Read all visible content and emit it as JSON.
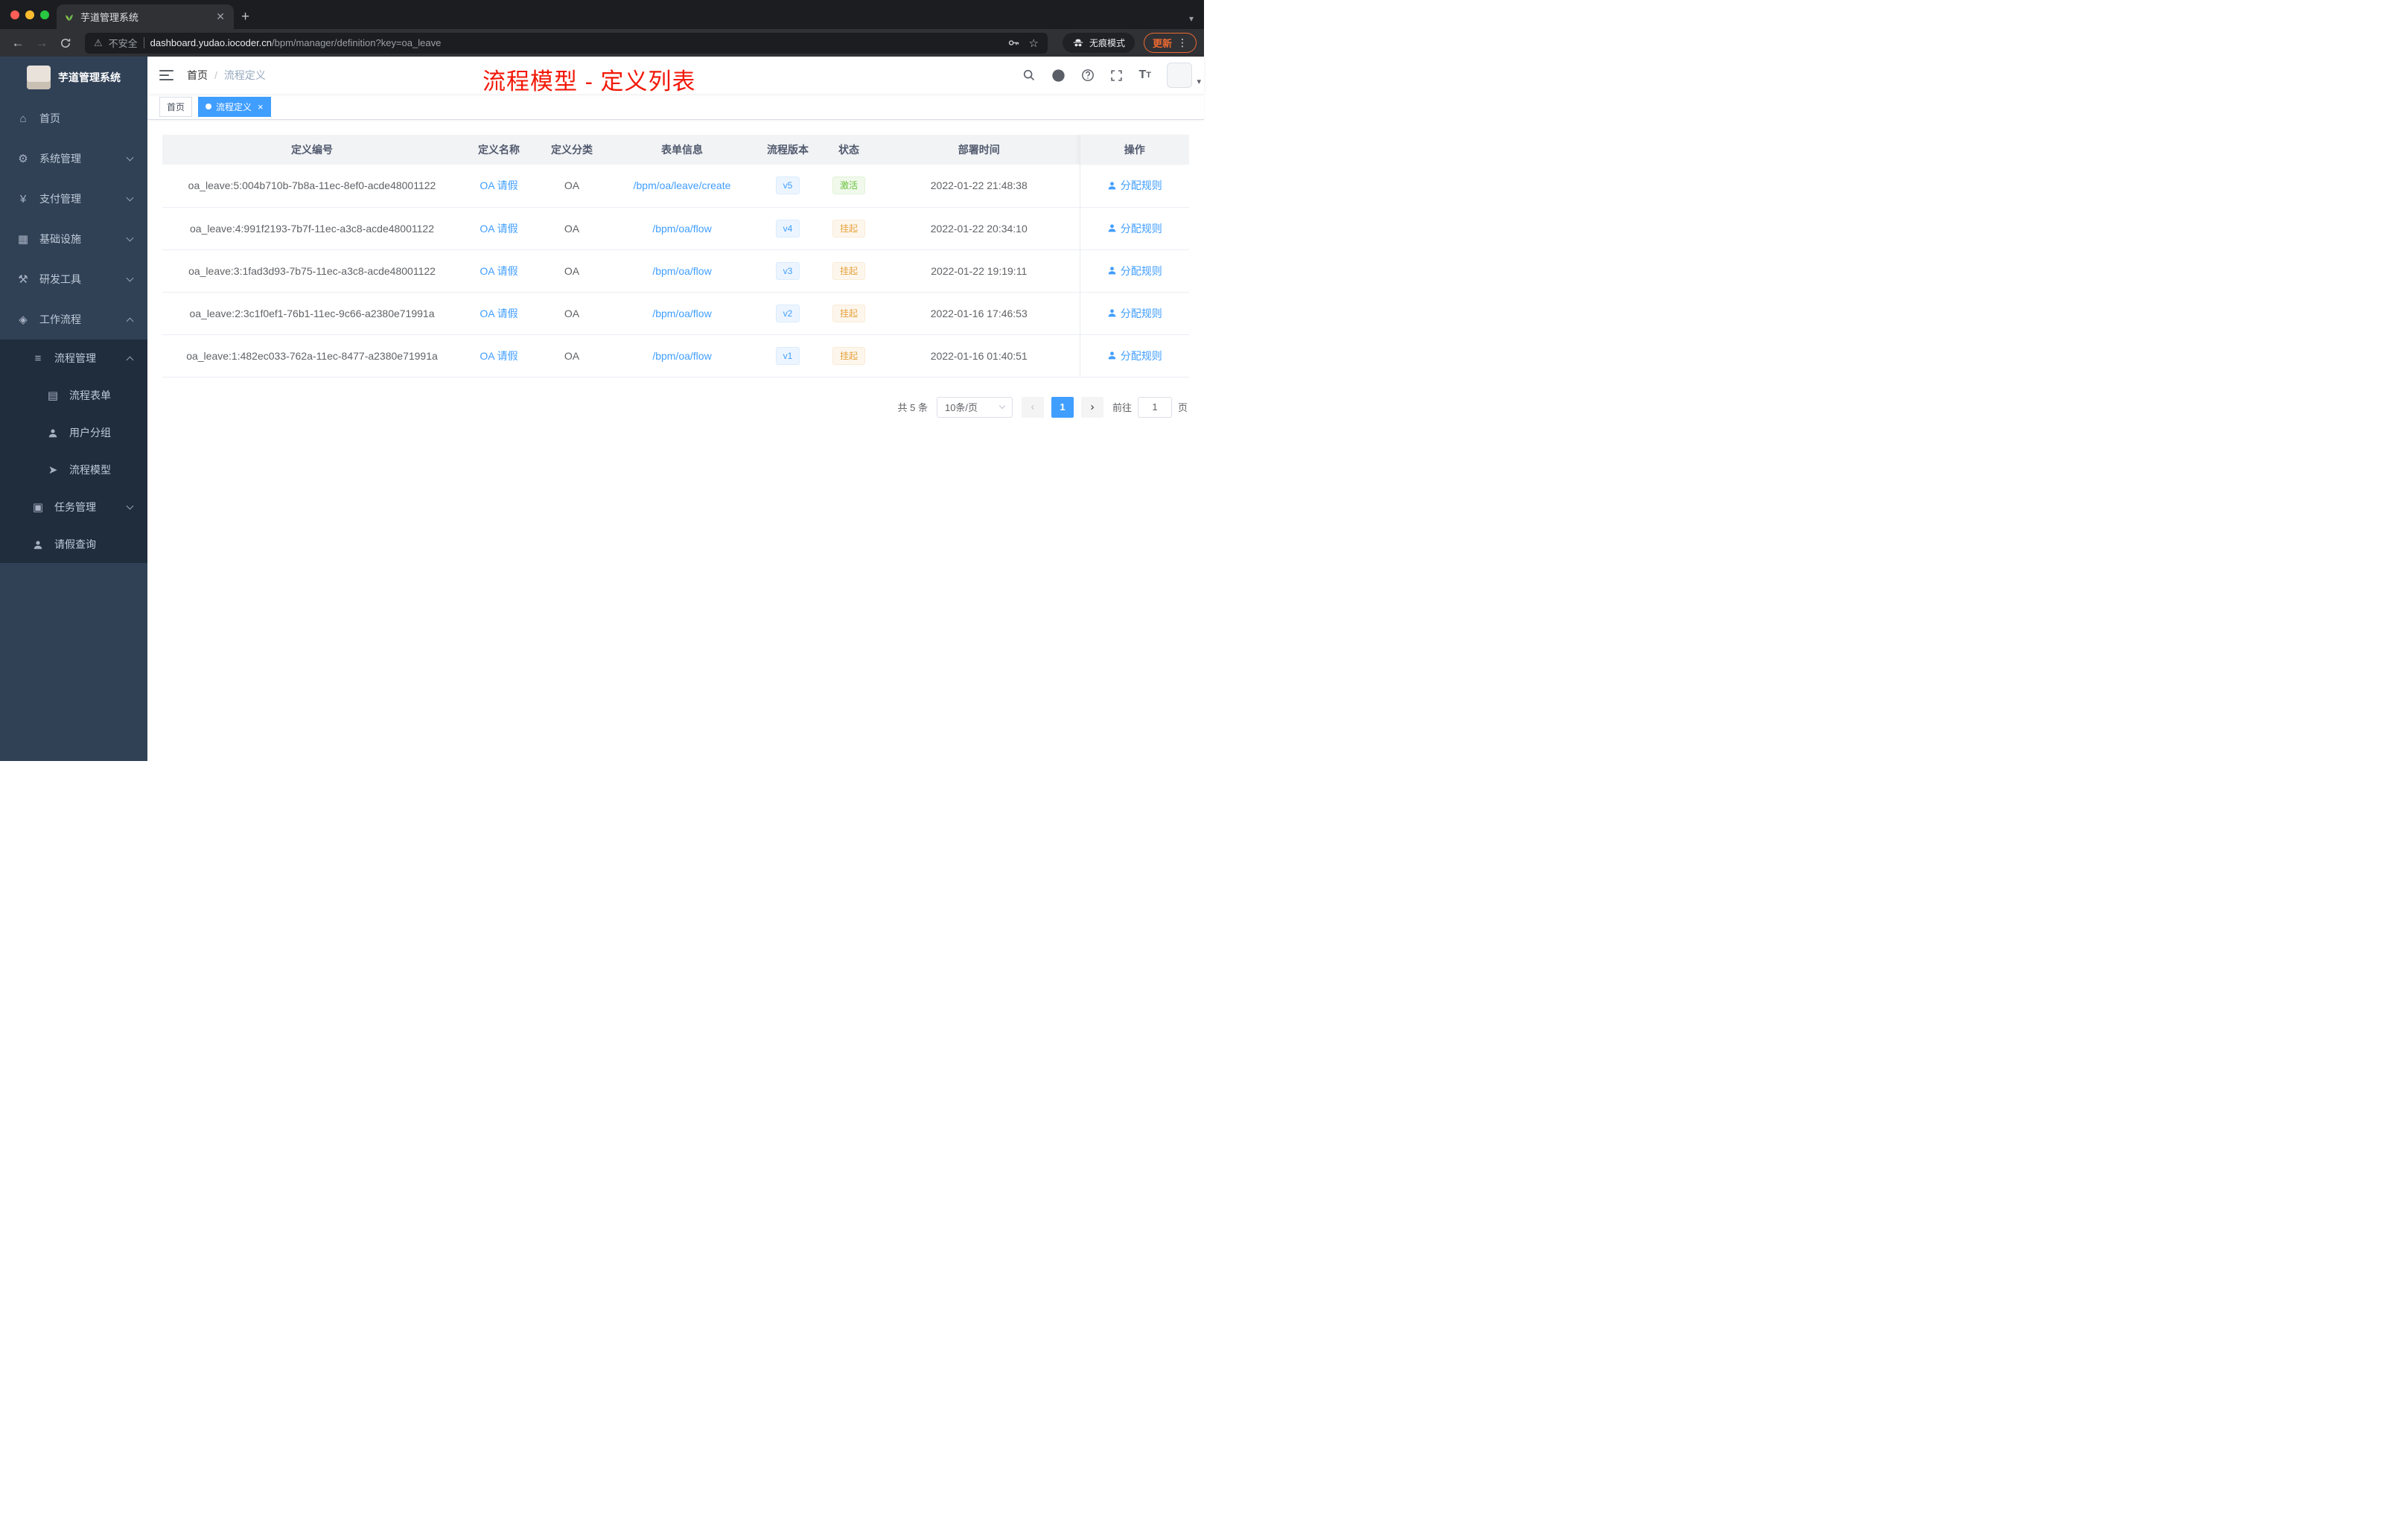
{
  "browser": {
    "tab_title": "芋道管理系统",
    "security_warning": "不安全",
    "url_host": "dashboard.yudao.iocoder.cn",
    "url_path": "/bpm/manager/definition?key=oa_leave",
    "incognito_label": "无痕模式",
    "update_label": "更新"
  },
  "sidebar": {
    "logo_title": "芋道管理系统",
    "items": {
      "home": "首页",
      "system": "系统管理",
      "payment": "支付管理",
      "infra": "基础设施",
      "devtools": "研发工具",
      "workflow": "工作流程",
      "process_mgmt": "流程管理",
      "process_form": "流程表单",
      "user_group": "用户分组",
      "process_model": "流程模型",
      "task_mgmt": "任务管理",
      "leave_query": "请假查询"
    }
  },
  "navbar": {
    "breadcrumb_home": "首页",
    "breadcrumb_sep": "/",
    "breadcrumb_current": "流程定义"
  },
  "annotation": "流程模型 - 定义列表",
  "tags": {
    "first": "首页",
    "active": "流程定义"
  },
  "table": {
    "columns": {
      "id": "定义编号",
      "name": "定义名称",
      "category": "定义分类",
      "form": "表单信息",
      "version": "流程版本",
      "status": "状态",
      "deploy_time": "部署时间",
      "action": "操作"
    },
    "rows": [
      {
        "id": "oa_leave:5:004b710b-7b8a-11ec-8ef0-acde48001122",
        "name": "OA 请假",
        "category": "OA",
        "form": "/bpm/oa/leave/create",
        "version": "v5",
        "status": "激活",
        "time": "2022-01-22 21:48:38",
        "action": "分配规则"
      },
      {
        "id": "oa_leave:4:991f2193-7b7f-11ec-a3c8-acde48001122",
        "name": "OA 请假",
        "category": "OA",
        "form": "/bpm/oa/flow",
        "version": "v4",
        "status": "挂起",
        "time": "2022-01-22 20:34:10",
        "action": "分配规则"
      },
      {
        "id": "oa_leave:3:1fad3d93-7b75-11ec-a3c8-acde48001122",
        "name": "OA 请假",
        "category": "OA",
        "form": "/bpm/oa/flow",
        "version": "v3",
        "status": "挂起",
        "time": "2022-01-22 19:19:11",
        "action": "分配规则"
      },
      {
        "id": "oa_leave:2:3c1f0ef1-76b1-11ec-9c66-a2380e71991a",
        "name": "OA 请假",
        "category": "OA",
        "form": "/bpm/oa/flow",
        "version": "v2",
        "status": "挂起",
        "time": "2022-01-16 17:46:53",
        "action": "分配规则"
      },
      {
        "id": "oa_leave:1:482ec033-762a-11ec-8477-a2380e71991a",
        "name": "OA 请假",
        "category": "OA",
        "form": "/bpm/oa/flow",
        "version": "v1",
        "status": "挂起",
        "time": "2022-01-16 01:40:51",
        "action": "分配规则"
      }
    ]
  },
  "pagination": {
    "total": "共 5 条",
    "page_size": "10条/页",
    "current_page": "1",
    "goto_label": "前往",
    "goto_value": "1",
    "page_unit": "页"
  },
  "colors": {
    "accent": "#409eff",
    "status_active_green": "#67c23a",
    "status_suspended_orange": "#e6a23c",
    "annotation_red": "#f21808",
    "sidebar_bg": "#304156",
    "sidebar_submenu_bg": "#1f2d3d"
  }
}
